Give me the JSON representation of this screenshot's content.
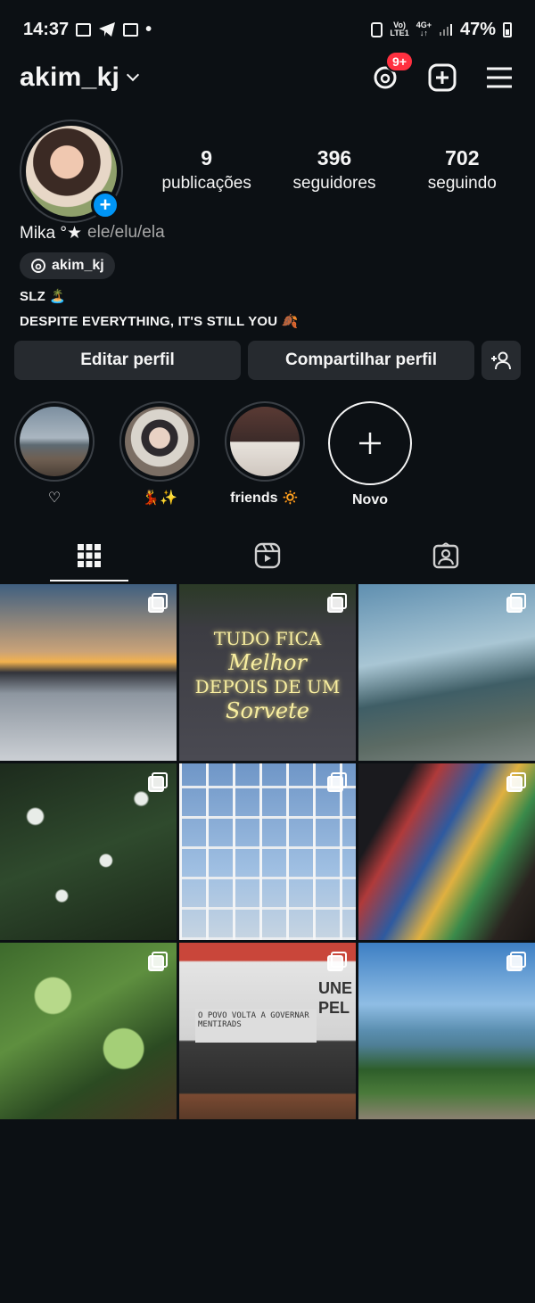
{
  "status_bar": {
    "time": "14:37",
    "dot": "•",
    "net_top": "Vo)",
    "net_bottom": "LTE1",
    "net2_top": "4G+",
    "net2_bottom": "↓↑",
    "battery": "47%"
  },
  "header": {
    "username": "akim_kj",
    "threads_badge": "9+"
  },
  "stats": [
    {
      "value": "9",
      "label": "publicações"
    },
    {
      "value": "396",
      "label": "seguidores"
    },
    {
      "value": "702",
      "label": "seguindo"
    }
  ],
  "bio": {
    "name": "Mika °★",
    "pronouns": "ele/elu/ela",
    "threads_handle": "akim_kj",
    "line1": "SLZ 🏝️",
    "line2": "DESPITE EVERYTHING, IT'S STILL YOU 🍂"
  },
  "actions": {
    "edit": "Editar perfil",
    "share": "Compartilhar perfil"
  },
  "highlights": [
    {
      "label": "♡"
    },
    {
      "label": "💃✨"
    },
    {
      "label": "friends 🔅"
    },
    {
      "label": "Novo"
    }
  ],
  "posts": {
    "p2_text": [
      "TUDO FICA",
      "Melhor",
      "DEPOIS DE UM",
      "Sorvete"
    ],
    "p8_graffiti": "O POVO VOLTA A GOVERNAR MENTIRADS",
    "p8_wall": [
      "UNE",
      "PEL"
    ]
  },
  "colors": {
    "background": "#0c1014",
    "button": "#262a2f",
    "accent_blue": "#0095f6",
    "badge_red": "#ff3040"
  }
}
